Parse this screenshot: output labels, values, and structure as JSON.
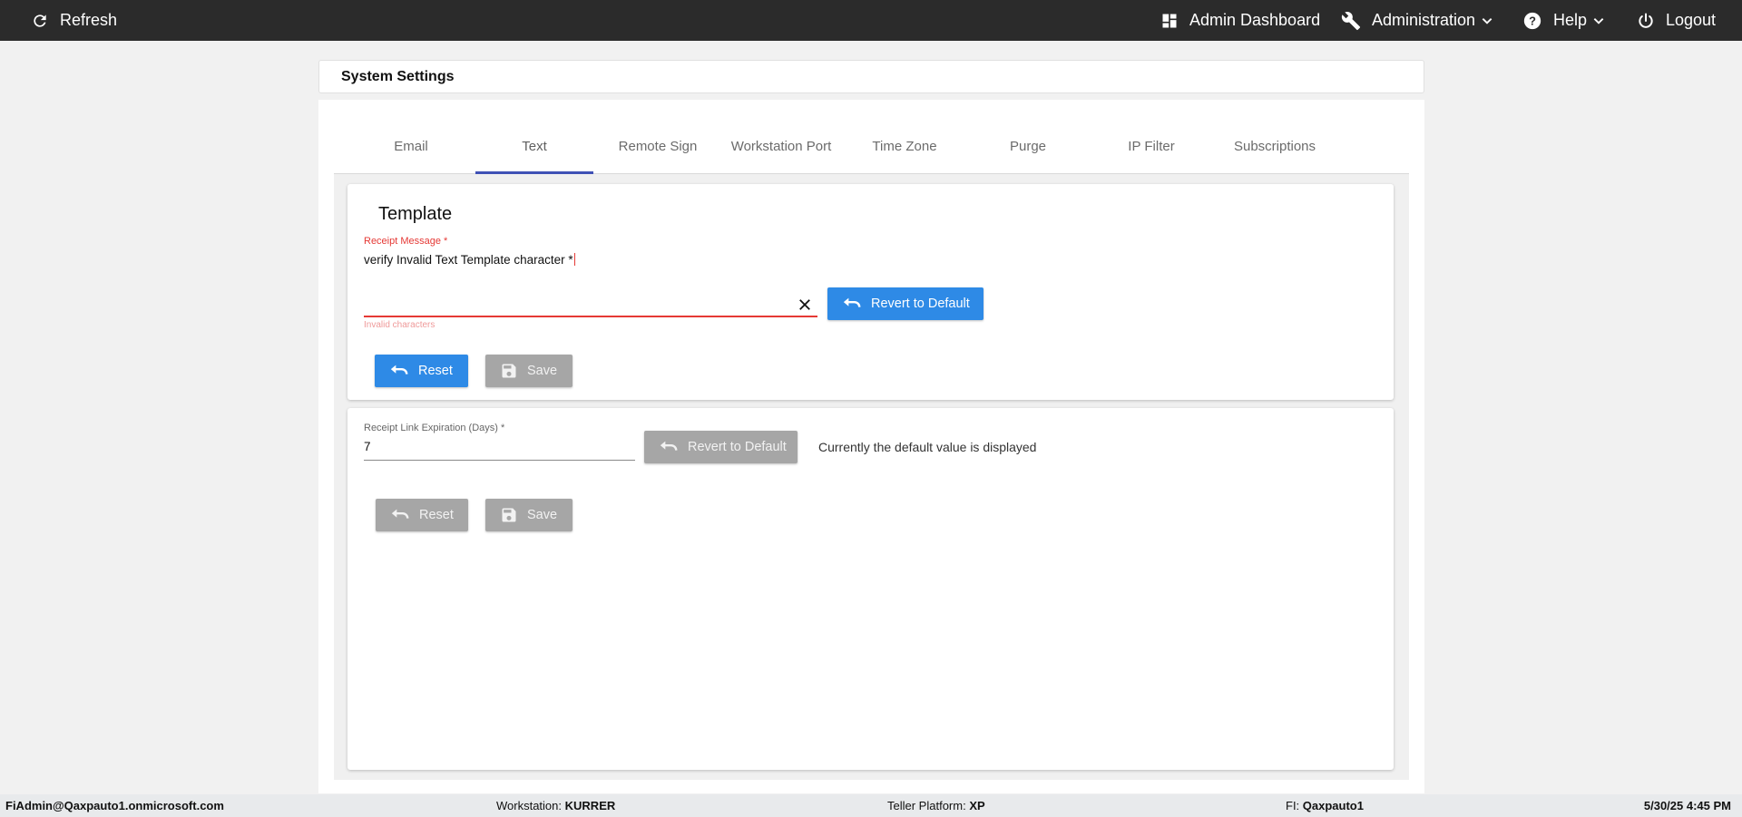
{
  "topbar": {
    "refresh_label": "Refresh",
    "admin_dashboard_label": "Admin Dashboard",
    "administration_label": "Administration",
    "help_label": "Help",
    "logout_label": "Logout"
  },
  "page": {
    "title": "System Settings"
  },
  "tabs": [
    {
      "label": "Email"
    },
    {
      "label": "Text",
      "active": true
    },
    {
      "label": "Remote Sign"
    },
    {
      "label": "Workstation Port"
    },
    {
      "label": "Time Zone"
    },
    {
      "label": "Purge"
    },
    {
      "label": "IP Filter"
    },
    {
      "label": "Subscriptions"
    }
  ],
  "template_section": {
    "title": "Template",
    "receipt_message": {
      "label": "Receipt Message *",
      "value": "verify Invalid Text Template character *",
      "error": "Invalid characters"
    },
    "revert_label": "Revert to Default",
    "reset_label": "Reset",
    "save_label": "Save"
  },
  "expiration_section": {
    "field": {
      "label": "Receipt Link Expiration (Days) *",
      "value": "7"
    },
    "revert_label": "Revert to Default",
    "note": "Currently the default value is displayed",
    "reset_label": "Reset",
    "save_label": "Save"
  },
  "footer": {
    "user": "FiAdmin@Qaxpauto1.onmicrosoft.com",
    "workstation_label": "Workstation:",
    "workstation_value": "KURRER",
    "platform_label": "Teller Platform:",
    "platform_value": "XP",
    "fi_label": "FI:",
    "fi_value": "Qaxpauto1",
    "datetime": "5/30/25 4:45 PM"
  },
  "colors": {
    "topbar": "#2b2b2b",
    "primary_button": "#2e8ae6",
    "disabled_button": "#a6a6a6",
    "tab_indicator": "#3f51b5",
    "error": "#e53935"
  },
  "icons": [
    "refresh-icon",
    "dashboard-icon",
    "wrench-icon",
    "help-icon",
    "power-icon",
    "chevron-down-icon",
    "undo-icon",
    "save-icon",
    "close-icon"
  ]
}
